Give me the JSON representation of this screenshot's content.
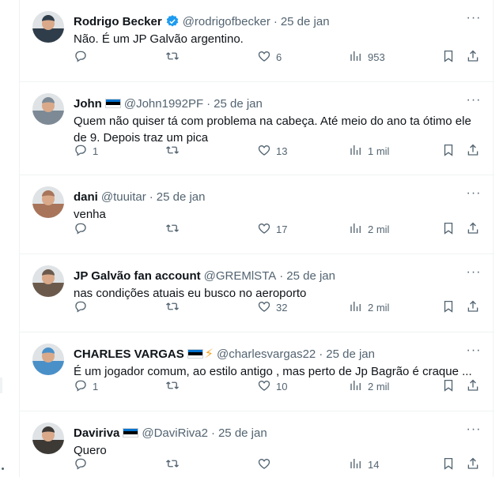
{
  "tweets": [
    {
      "name": "Rodrigo Becker",
      "verified": true,
      "flag": false,
      "extra_icon": "",
      "handle": "@rodrigofbecker",
      "date": "25 de jan",
      "text": "Não. É um JP Galvão argentino.",
      "replies": "",
      "retweets": "",
      "likes": "6",
      "views": "953",
      "avatar_color": "#2f3d4a"
    },
    {
      "name": "John",
      "verified": false,
      "flag": true,
      "extra_icon": "",
      "handle": "@John1992PF",
      "date": "25 de jan",
      "text": "Quem não quiser tá com problema na cabeça. Até meio do ano ta ótimo ele de 9. Depois traz um pica",
      "replies": "1",
      "retweets": "",
      "likes": "13",
      "views": "1 mil",
      "avatar_color": "#7d8a96"
    },
    {
      "name": "dani",
      "verified": false,
      "flag": false,
      "extra_icon": "",
      "handle": "@tuuitar",
      "date": "25 de jan",
      "text": "venha",
      "replies": "",
      "retweets": "",
      "likes": "17",
      "views": "2 mil",
      "avatar_color": "#a8755a"
    },
    {
      "name": "JP Galvão fan account",
      "verified": false,
      "flag": false,
      "extra_icon": "",
      "handle": "@GREMlSTA",
      "date": "25 de jan",
      "text": "nas condições atuais eu busco no aeroporto",
      "replies": "",
      "retweets": "",
      "likes": "32",
      "views": "2 mil",
      "avatar_color": "#6b5a4c"
    },
    {
      "name": "CHARLES VARGAS",
      "verified": false,
      "flag": true,
      "extra_icon": "⚡",
      "handle": "@charlesvargas22",
      "date": "25 de jan",
      "text": "É um jogador comum, ao estilo antigo , mas perto de Jp Bagrão é craque ...",
      "replies": "1",
      "retweets": "",
      "likes": "10",
      "views": "2 mil",
      "avatar_color": "#4a90c8"
    },
    {
      "name": "Daviriva",
      "verified": false,
      "flag": true,
      "extra_icon": "",
      "handle": "@DaviRiva2",
      "date": "25 de jan",
      "text": "Quero",
      "replies": "",
      "retweets": "",
      "likes": "",
      "views": "14",
      "avatar_color": "#3d3a36"
    }
  ],
  "icons": {
    "more": "more-icon",
    "reply": "reply-icon",
    "retweet": "retweet-icon",
    "like": "heart-icon",
    "views": "views-icon",
    "bookmark": "bookmark-icon",
    "share": "share-icon"
  },
  "colors": {
    "text": "#0f1419",
    "muted": "#536471",
    "verified": "#1d9bf0",
    "divider": "#eff3f4",
    "flag_blue": "#0072ce",
    "flag_black": "#000000",
    "flag_white": "#ffffff"
  }
}
